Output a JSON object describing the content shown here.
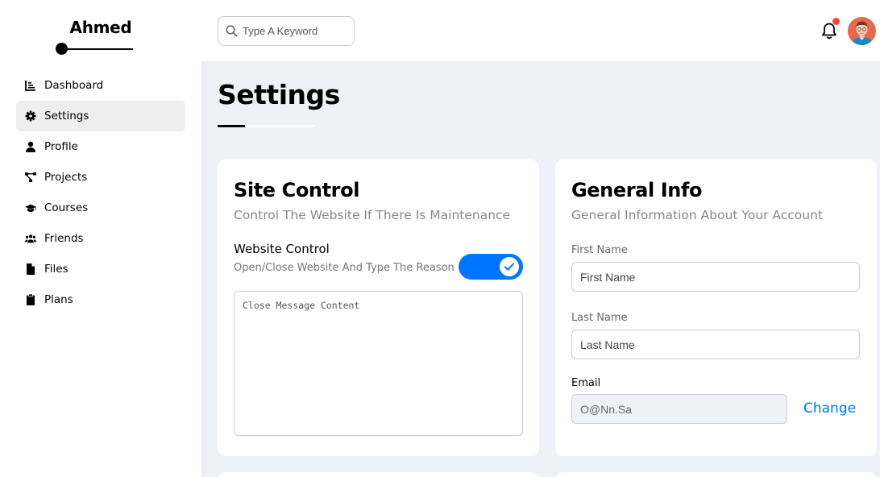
{
  "sidebar": {
    "brand": "Ahmed",
    "items": [
      {
        "label": "Dashboard",
        "icon": "chart-icon"
      },
      {
        "label": "Settings",
        "icon": "gear-icon"
      },
      {
        "label": "Profile",
        "icon": "user-icon"
      },
      {
        "label": "Projects",
        "icon": "diagram-icon"
      },
      {
        "label": "Courses",
        "icon": "graduation-cap-icon"
      },
      {
        "label": "Friends",
        "icon": "users-icon"
      },
      {
        "label": "Files",
        "icon": "file-icon"
      },
      {
        "label": "Plans",
        "icon": "clipboard-icon"
      }
    ],
    "active_item": "Settings"
  },
  "header": {
    "search_placeholder": "Type A Keyword",
    "notification_badge_color": "#f44336"
  },
  "main": {
    "title": "Settings",
    "site_control": {
      "title": "Site Control",
      "subtitle": "Control The Website If There Is Maintenance",
      "control_label": "Website Control",
      "control_description": "Open/Close Website And Type The Reason",
      "toggle_on": true,
      "message_placeholder": "Close Message Content"
    },
    "general_info": {
      "title": "General Info",
      "subtitle": "General Information About Your Account",
      "first_name_label": "First Name",
      "first_name_placeholder": "First Name",
      "last_name_label": "Last Name",
      "last_name_placeholder": "Last Name",
      "email_label": "Email",
      "email_value": "O@Nn.Sa",
      "change_label": "Change"
    }
  },
  "colors": {
    "accent": "#0075ff",
    "background": "#eef1f7"
  }
}
